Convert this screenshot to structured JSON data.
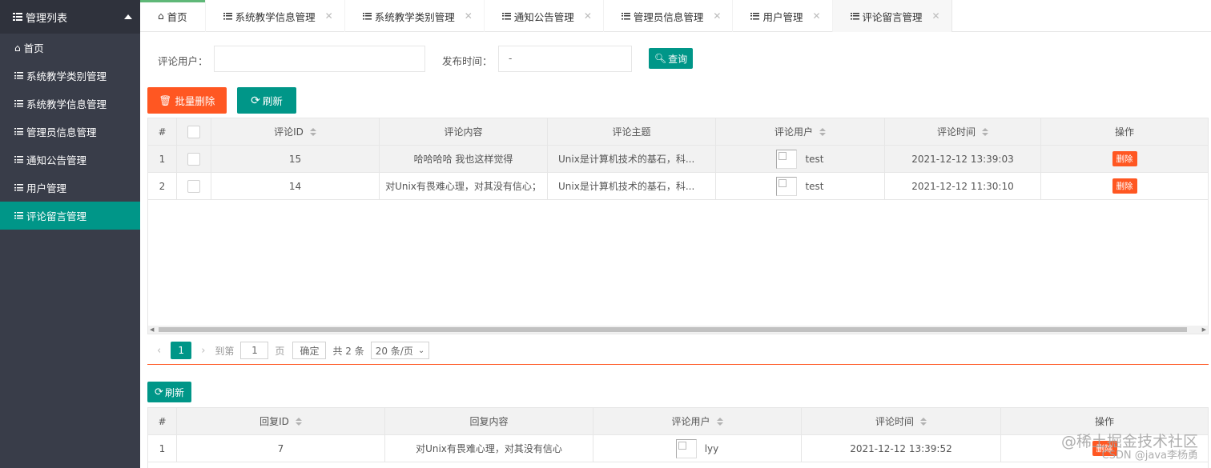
{
  "sidebar": {
    "title": "管理列表",
    "items": [
      {
        "label": "首页",
        "icon": "home-icon"
      },
      {
        "label": "系统教学类别管理",
        "icon": "list-icon"
      },
      {
        "label": "系统教学信息管理",
        "icon": "list-icon"
      },
      {
        "label": "管理员信息管理",
        "icon": "list-icon"
      },
      {
        "label": "通知公告管理",
        "icon": "list-icon"
      },
      {
        "label": "用户管理",
        "icon": "list-icon"
      },
      {
        "label": "评论留言管理",
        "icon": "list-icon",
        "active": true
      }
    ]
  },
  "tabs": [
    {
      "label": "首页"
    },
    {
      "label": "系统教学信息管理"
    },
    {
      "label": "系统教学类别管理"
    },
    {
      "label": "通知公告管理"
    },
    {
      "label": "管理员信息管理"
    },
    {
      "label": "用户管理"
    },
    {
      "label": "评论留言管理",
      "active": true
    }
  ],
  "search": {
    "user_label": "评论用户：",
    "user_value": "",
    "time_label": "发布时间：",
    "time_value": "-",
    "query_label": "查询"
  },
  "toolbar": {
    "batch_delete_label": "批量删除",
    "refresh_label": "刷新"
  },
  "comments_table": {
    "headers": [
      "#",
      "",
      "评论ID",
      "评论内容",
      "评论主题",
      "评论用户",
      "评论时间",
      "操作"
    ],
    "rows": [
      {
        "index": "1",
        "id": "15",
        "content": "哈哈哈哈  我也这样觉得",
        "topic": "Unix是计算机技术的基石，科...",
        "user": "test",
        "time": "2021-12-12 13:39:03",
        "action": "删除"
      },
      {
        "index": "2",
        "id": "14",
        "content": "对Unix有畏难心理，对其没有信心；",
        "topic": "Unix是计算机技术的基石，科...",
        "user": "test",
        "time": "2021-12-12 11:30:10",
        "action": "删除"
      }
    ]
  },
  "pager": {
    "current_page": "1",
    "goto_label": "到第",
    "goto_value": "1",
    "page_unit": "页",
    "confirm_label": "确定",
    "total_label": "共 2 条",
    "page_size": "20 条/页"
  },
  "reply_toolbar": {
    "refresh_label": "刷新"
  },
  "replies_table": {
    "headers": [
      "#",
      "回复ID",
      "回复内容",
      "评论用户",
      "评论时间",
      "操作"
    ],
    "rows": [
      {
        "index": "1",
        "id": "7",
        "content": "对Unix有畏难心理，对其没有信心",
        "user": "lyy",
        "time": "2021-12-12 13:39:52",
        "action": "删除"
      }
    ]
  },
  "watermark": {
    "line1": "@稀土掘金技术社区",
    "line2": "CSDN @java李杨勇"
  },
  "colors": {
    "sidebar_bg": "#393d49",
    "accent": "#009688",
    "danger": "#ff5722",
    "tab_indicator": "#5fb878"
  }
}
